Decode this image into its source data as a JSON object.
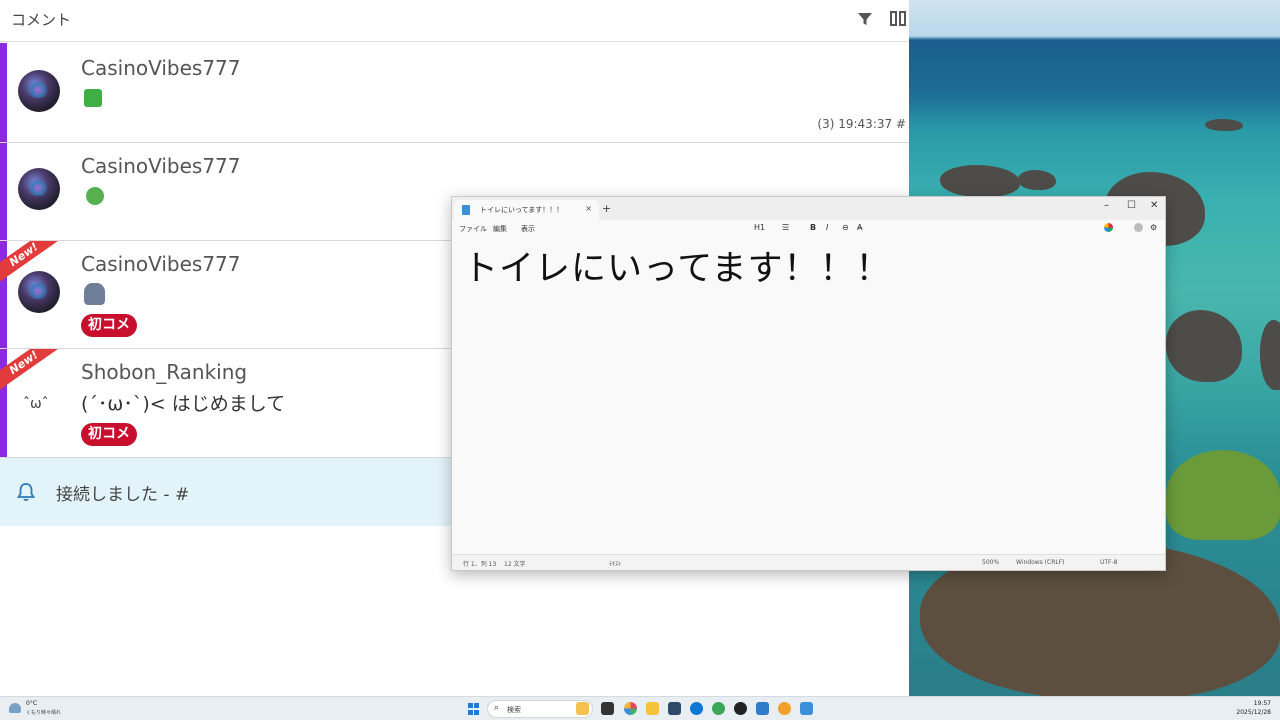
{
  "comment_app": {
    "title": "コメント",
    "comments": [
      {
        "user": "CasinoVibes777",
        "time_info": "(3)   19:43:37   #"
      },
      {
        "user": "CasinoVibes777"
      },
      {
        "user": "CasinoVibes777",
        "ribbon": "New!",
        "badge": "初コメ"
      },
      {
        "user": "Shobon_Ranking",
        "ribbon": "New!",
        "avatar_text": "ˆωˆ",
        "message": "(´･ω･`)< はじめまして",
        "badge": "初コメ"
      }
    ],
    "connection": {
      "text": "接続しました - #"
    }
  },
  "notepad": {
    "tab_title": "トイレにいってます！！！",
    "tab_close": "×",
    "new_tab": "+",
    "menu": [
      "ファイル",
      "編集",
      "表示"
    ],
    "toolbar": {
      "heading": "H1",
      "list": "☰",
      "bold": "B",
      "italic": "I",
      "link": "⊖",
      "clear": "A̶"
    },
    "window_controls": {
      "minimize": "–",
      "maximize": "☐",
      "close": "✕"
    },
    "content": "トイレにいってます！！！",
    "status": {
      "position": "行 1、列 13",
      "chars": "12 文字",
      "format": "ﾃｷｽﾄ",
      "zoom": "500%",
      "line_ending": "Windows (CRLF)",
      "encoding": "UTF-8"
    }
  },
  "taskbar": {
    "weather_temp": "0°C",
    "weather_desc": "くもり時々晴れ",
    "search_label": "検索",
    "time": "19:57",
    "date": "2025/12/28"
  },
  "icons": [
    "filter-icon",
    "columns-icon",
    "bell-icon",
    "notepad-icon",
    "windows-start-icon",
    "search-icon"
  ],
  "colors": {
    "accent_purple": "#8a2be2",
    "badge_red": "#c8102e",
    "ribbon_red": "#e23b3b",
    "connection_bg": "#e3f3fa"
  }
}
